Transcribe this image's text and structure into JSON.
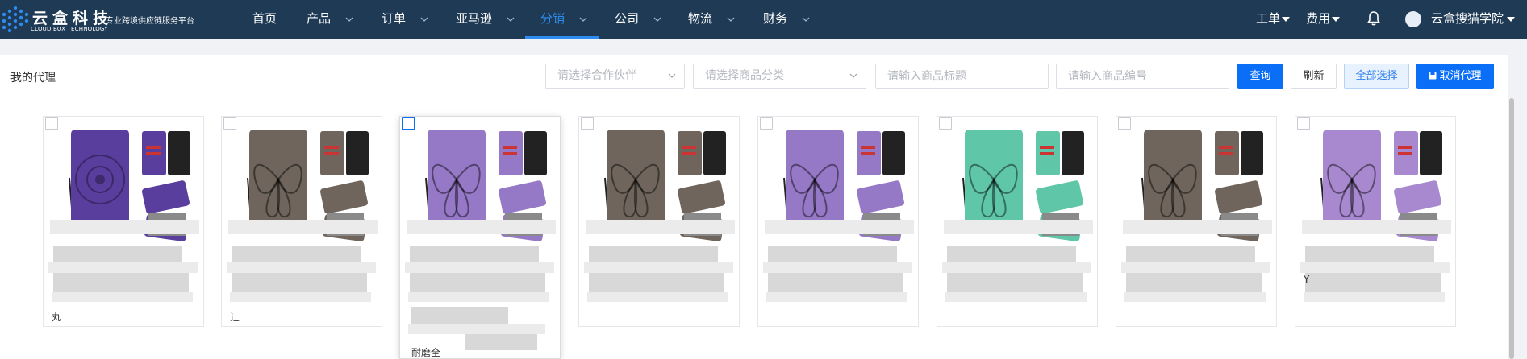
{
  "brand": {
    "name": "云盒科技",
    "slogan": "专业跨境供应链服务平台",
    "english": "CLOUD BOX TECHNOLOGY"
  },
  "nav": {
    "items": [
      {
        "label": "首页"
      },
      {
        "label": "产品"
      },
      {
        "label": "订单"
      },
      {
        "label": "亚马逊"
      },
      {
        "label": "分销"
      },
      {
        "label": "公司"
      },
      {
        "label": "物流"
      },
      {
        "label": "财务"
      }
    ],
    "active": "分销"
  },
  "user_menu": {
    "ticket": "工单",
    "fees": "费用",
    "notifications_icon": "bell-icon",
    "username": "云盒搜猫学院"
  },
  "toolbar": {
    "title": "我的代理",
    "partner_select": "请选择合作伙伴",
    "category_select": "请选择商品分类",
    "title_input_placeholder": "请输入商品标题",
    "code_input_placeholder": "请输入商品编号",
    "query": "查询",
    "refresh": "刷新",
    "select_all": "全部选择",
    "cancel_agency": "取消代理"
  },
  "colors": {
    "nav_bg": "#1f3a55",
    "accent": "#0a6ef6",
    "active_nav": "#2d8cf0"
  },
  "products": [
    {
      "case_color": "#5a3e9e",
      "pattern": "sunflower",
      "caption_fragment": "丸"
    },
    {
      "case_color": "#6f655c",
      "pattern": "butterfly",
      "caption_fragment": "辶"
    },
    {
      "case_color": "#9679c6",
      "pattern": "butterfly",
      "caption_fragment": "耐磨全"
    },
    {
      "case_color": "#6f655c",
      "pattern": "butterfly",
      "caption_fragment": ""
    },
    {
      "case_color": "#9679c6",
      "pattern": "butterfly",
      "caption_fragment": ""
    },
    {
      "case_color": "#5fc6a8",
      "pattern": "butterfly",
      "caption_fragment": ""
    },
    {
      "case_color": "#6f655c",
      "pattern": "butterfly",
      "caption_fragment": ""
    },
    {
      "case_color": "#a889cf",
      "pattern": "butterfly",
      "caption_fragment": "Y"
    }
  ]
}
